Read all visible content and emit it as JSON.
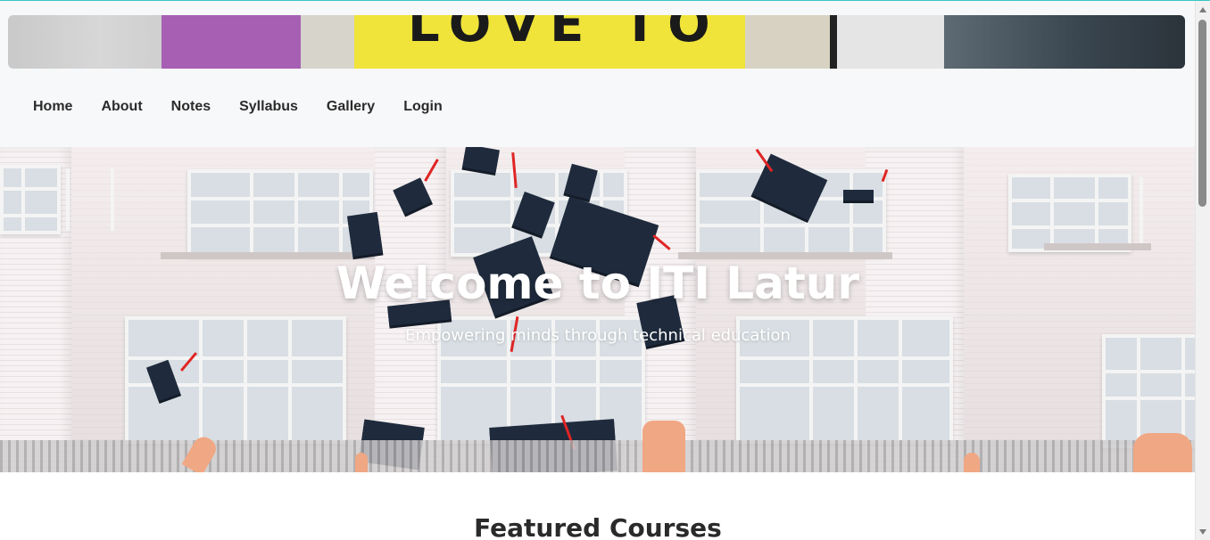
{
  "banner": {
    "image_text": "LOVE TO",
    "colors": [
      "#c9c9c9",
      "#a65fb3",
      "#d6d4cb",
      "#f0e43a",
      "#d7d2c2",
      "#e5e5e5",
      "#3a4650"
    ]
  },
  "nav": {
    "items": [
      {
        "label": "Home"
      },
      {
        "label": "About"
      },
      {
        "label": "Notes"
      },
      {
        "label": "Syllabus"
      },
      {
        "label": "Gallery"
      },
      {
        "label": "Login"
      }
    ]
  },
  "hero": {
    "title": "Welcome to ITI Latur",
    "subtitle": "Empowering minds through technical education",
    "image_subject": "graduation caps thrown in front of building"
  },
  "featured": {
    "title": "Featured Courses"
  },
  "colors": {
    "header_bg": "#f7f8fa",
    "nav_text": "#2b2b2b",
    "hero_text": "#ffffff",
    "scrollbar_thumb": "#8a8a8a"
  }
}
